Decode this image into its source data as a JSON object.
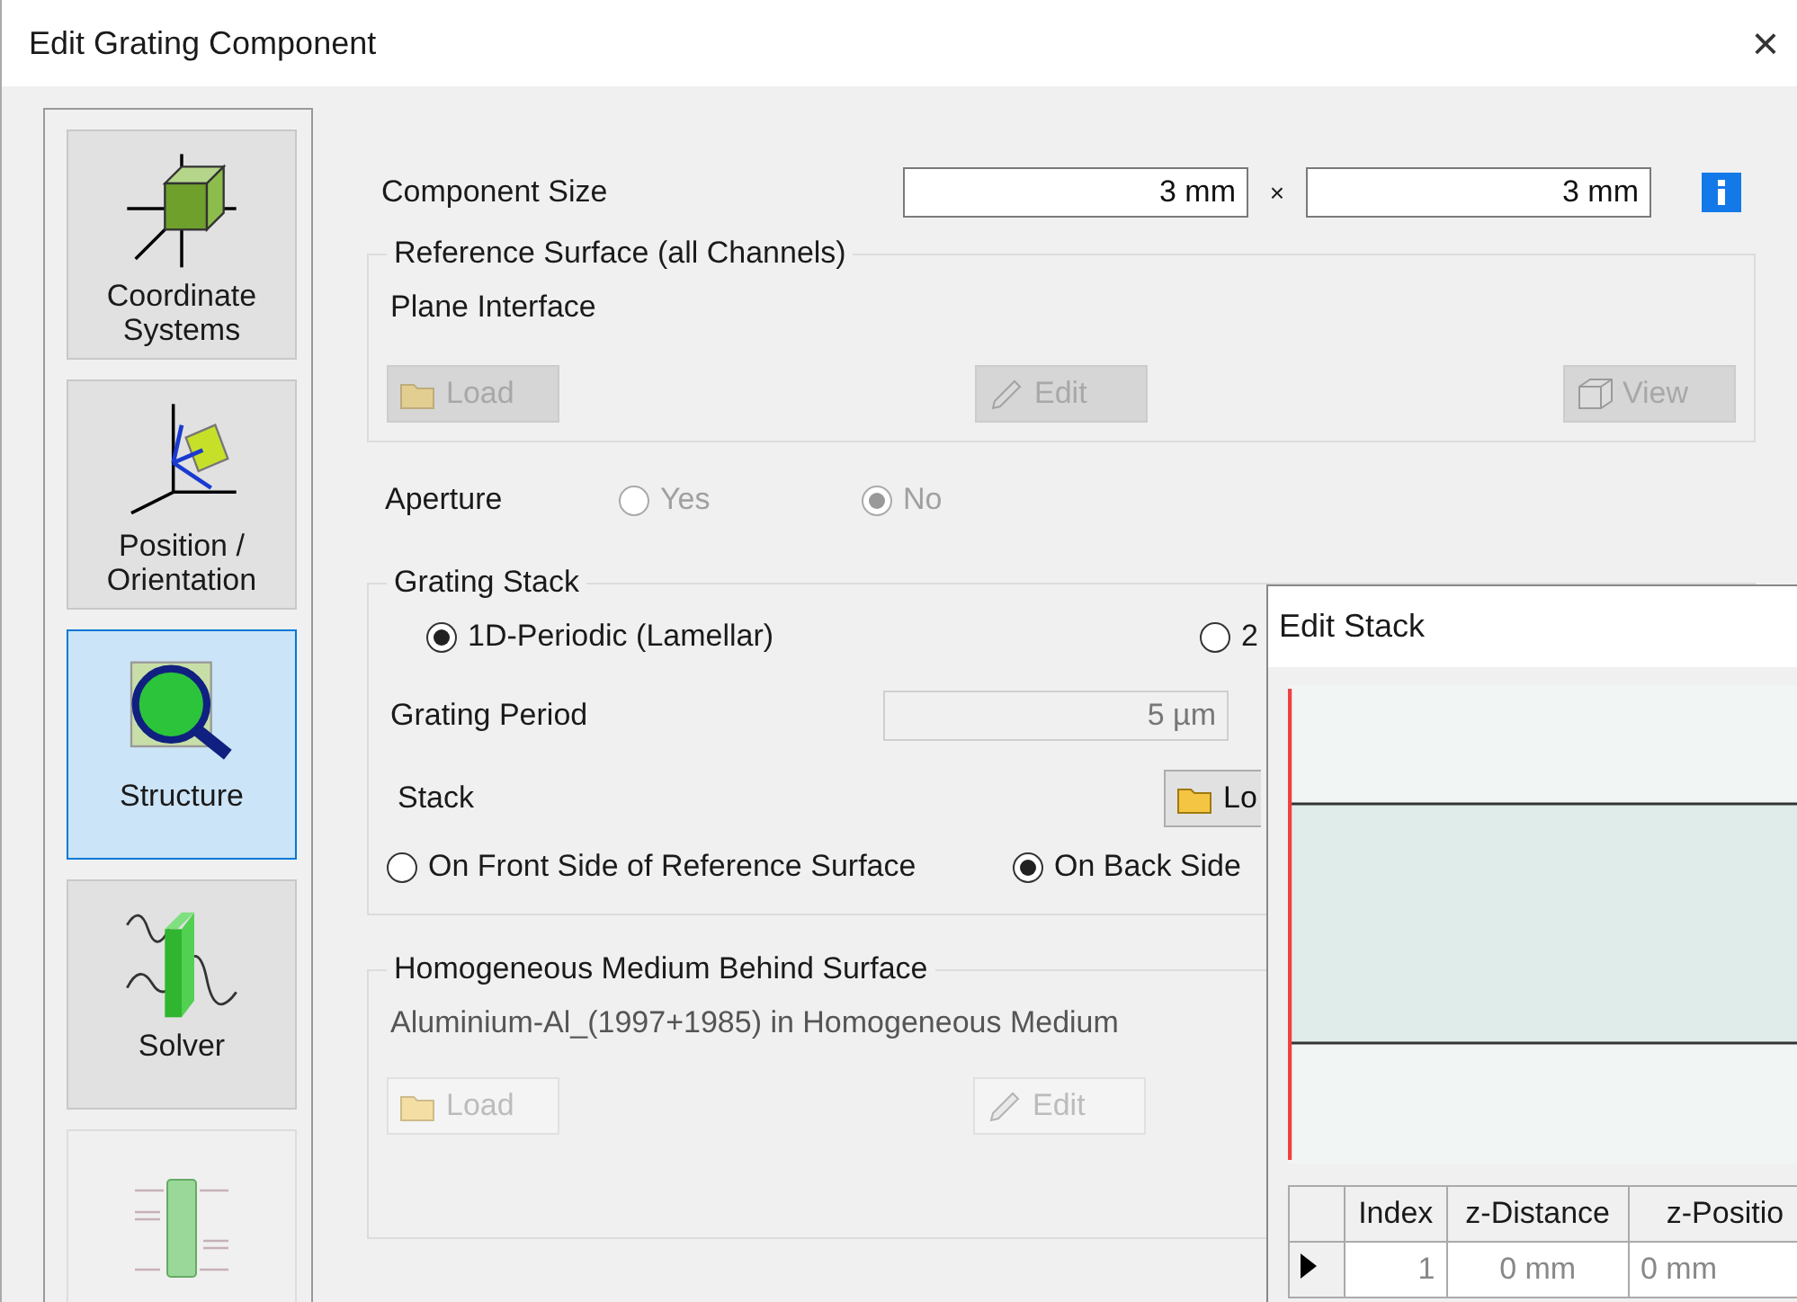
{
  "window": {
    "title": "Edit Grating Component",
    "close": "×"
  },
  "sidebar": {
    "items": [
      {
        "label": "Coordinate Systems",
        "selected": false,
        "disabled": false
      },
      {
        "label": "Position / Orientation",
        "selected": false,
        "disabled": false
      },
      {
        "label": "Structure",
        "selected": true,
        "disabled": false
      },
      {
        "label": "Solver",
        "selected": false,
        "disabled": false
      },
      {
        "selected": false,
        "disabled": true
      }
    ]
  },
  "component_size": {
    "label": "Component Size",
    "width": "3 mm",
    "separator": "×",
    "height": "3 mm"
  },
  "reference_surface": {
    "title": "Reference Surface (all Channels)",
    "value": "Plane Interface",
    "buttons": [
      {
        "label": "Load",
        "kind": "load",
        "disabled": true
      },
      {
        "label": "Edit",
        "kind": "edit",
        "disabled": true
      },
      {
        "label": "View",
        "kind": "view",
        "disabled": true
      }
    ]
  },
  "aperture": {
    "label": "Aperture",
    "options": [
      {
        "label": "Yes",
        "selected": false,
        "disabled": true
      },
      {
        "label": "No",
        "selected": true,
        "disabled": true
      }
    ]
  },
  "grating_stack": {
    "title": "Grating Stack",
    "types": [
      {
        "label": "1D-Periodic (Lamellar)",
        "selected": true,
        "disabled": false
      },
      {
        "label": "2",
        "selected": false,
        "disabled": false
      }
    ],
    "period_label": "Grating Period",
    "period": "5 µm",
    "stack_label": "Stack",
    "stack_button": {
      "label": "Lo",
      "kind": "load",
      "disabled": false
    },
    "sides": [
      {
        "label": "On Front Side of Reference Surface",
        "selected": false,
        "disabled": false
      },
      {
        "label": "On Back Side",
        "selected": true,
        "disabled": false
      }
    ]
  },
  "medium": {
    "title": "Homogeneous Medium Behind Surface",
    "value": "Aluminium-Al_(1997+1985) in Homogeneous Medium",
    "buttons": [
      {
        "label": "Load",
        "kind": "load",
        "disabled": true
      },
      {
        "label": "Edit",
        "kind": "edit",
        "disabled": true
      }
    ]
  },
  "edit_stack": {
    "title": "Edit Stack",
    "table": {
      "columns": [
        "Index",
        "z-Distance",
        "z-Positio"
      ],
      "rows": [
        {
          "current": true,
          "cells": [
            "1",
            "0 mm",
            "0 mm"
          ]
        }
      ]
    }
  }
}
